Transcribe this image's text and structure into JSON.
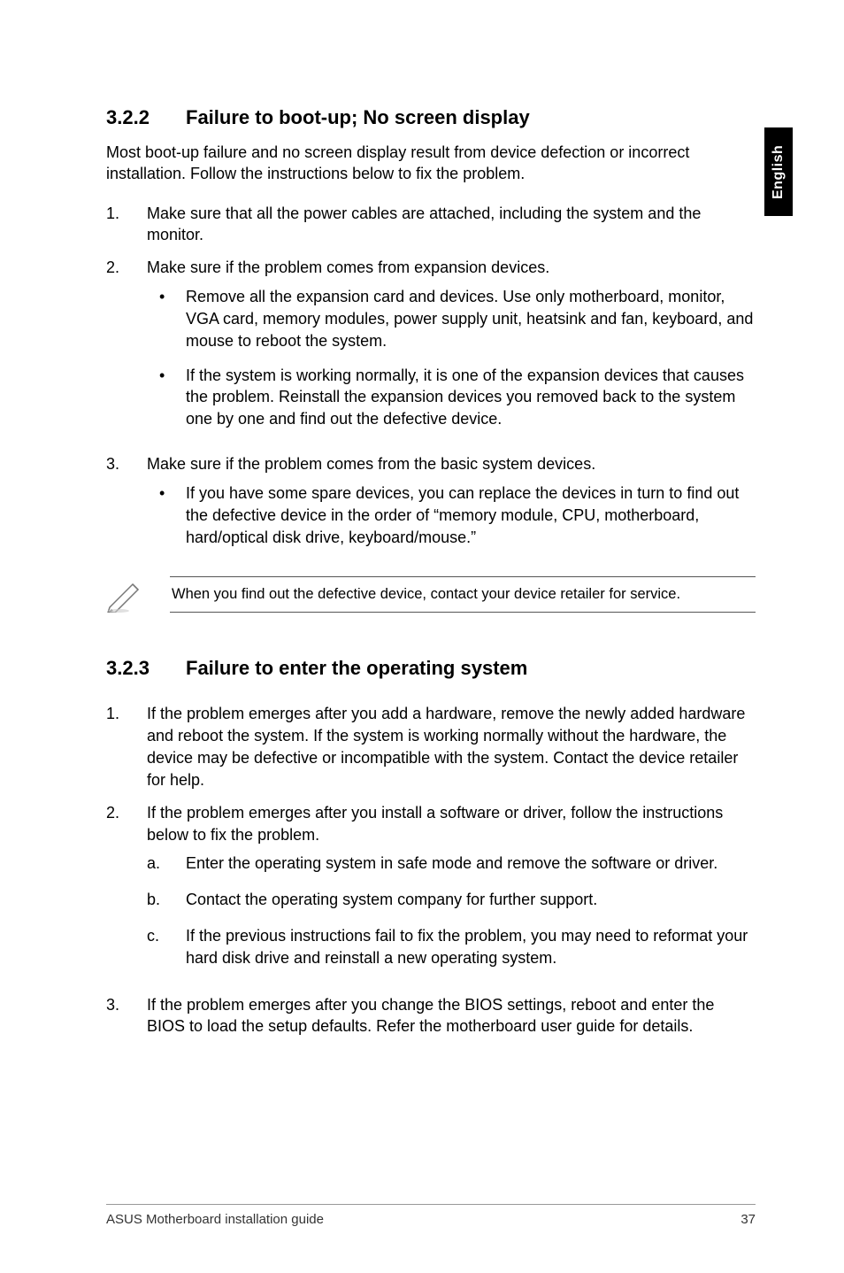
{
  "sideTab": "English",
  "section322": {
    "number": "3.2.2",
    "title": "Failure to boot-up; No screen display",
    "intro": "Most boot-up failure and no screen display result from device defection or incorrect installation. Follow the instructions below to fix the problem.",
    "items": [
      {
        "marker": "1.",
        "text": "Make sure that all the power cables are attached, including the system and the monitor."
      },
      {
        "marker": "2.",
        "text": "Make sure if the problem comes from expansion devices.",
        "bullets": [
          "Remove all the expansion card and devices. Use only motherboard, monitor, VGA card, memory modules, power supply unit, heatsink and fan, keyboard, and mouse to reboot the system.",
          "If the system is working normally, it is one of the expansion devices that causes the problem. Reinstall the expansion devices you removed back to the system one by one and find out the defective device."
        ]
      },
      {
        "marker": "3.",
        "text": "Make sure if the problem comes from the basic system devices.",
        "bullets": [
          "If you have some spare devices, you can replace the devices in turn to find out the defective device in the order of “memory module, CPU, motherboard, hard/optical disk drive, keyboard/mouse.”"
        ]
      }
    ],
    "note": "When you find out the defective device, contact your device retailer for service."
  },
  "section323": {
    "number": "3.2.3",
    "title": "Failure to enter the operating system",
    "items": [
      {
        "marker": "1.",
        "text": "If the problem emerges after you add a hardware, remove the newly added hardware and reboot the system. If the system is working normally without the hardware, the device may be defective or incompatible with the system. Contact the device retailer for help."
      },
      {
        "marker": "2.",
        "text": "If the problem emerges after you install a software or driver, follow the instructions below to fix the problem.",
        "alpha": [
          {
            "letter": "a.",
            "txt": "Enter the operating system in safe mode and remove the software or driver."
          },
          {
            "letter": "b.",
            "txt": "Contact the operating system company for further support."
          },
          {
            "letter": "c.",
            "txt": "If the previous instructions fail to fix the problem, you may need to reformat your hard disk drive and reinstall a new operating system."
          }
        ]
      },
      {
        "marker": "3.",
        "text": "If the problem emerges after you change the BIOS settings, reboot and enter the BIOS to load the setup defaults. Refer the motherboard user guide for details."
      }
    ]
  },
  "footer": {
    "left": "ASUS Motherboard installation guide",
    "right": "37"
  }
}
